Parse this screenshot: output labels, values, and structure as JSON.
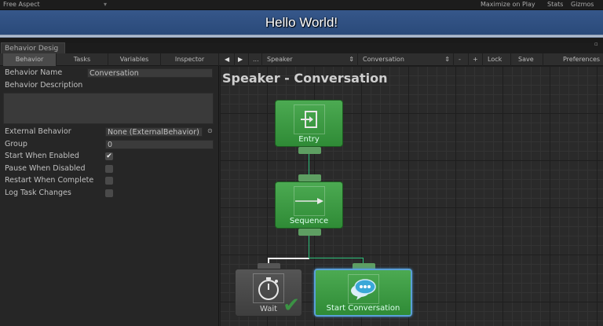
{
  "topbar": {
    "aspect": "Free Aspect",
    "maximize": "Maximize on Play",
    "stats": "Stats",
    "gizmos": "Gizmos"
  },
  "game_view": {
    "text": "Hello World!"
  },
  "window_tab": "Behavior Desig",
  "toolbar": {
    "tabs": [
      "Behavior",
      "Tasks",
      "Variables",
      "Inspector"
    ],
    "back": "◀",
    "forward": "▶",
    "more": "...",
    "object": "Speaker",
    "tree": "Conversation",
    "minus": "-",
    "plus": "+",
    "lock": "Lock",
    "save": "Save",
    "preferences": "Preferences"
  },
  "inspector": {
    "name_label": "Behavior Name",
    "name_value": "Conversation",
    "desc_label": "Behavior Description",
    "desc_value": "",
    "external_label": "External Behavior",
    "external_value": "None (ExternalBehavior)",
    "group_label": "Group",
    "group_value": "0",
    "checks": [
      {
        "label": "Start When Enabled",
        "checked": true
      },
      {
        "label": "Pause When Disabled",
        "checked": false
      },
      {
        "label": "Restart When Complete",
        "checked": false
      },
      {
        "label": "Log Task Changes",
        "checked": false
      }
    ]
  },
  "graph": {
    "title": "Speaker - Conversation",
    "nodes": {
      "entry": "Entry",
      "sequence": "Sequence",
      "wait": "Wait",
      "start": "Start Conversation"
    }
  }
}
